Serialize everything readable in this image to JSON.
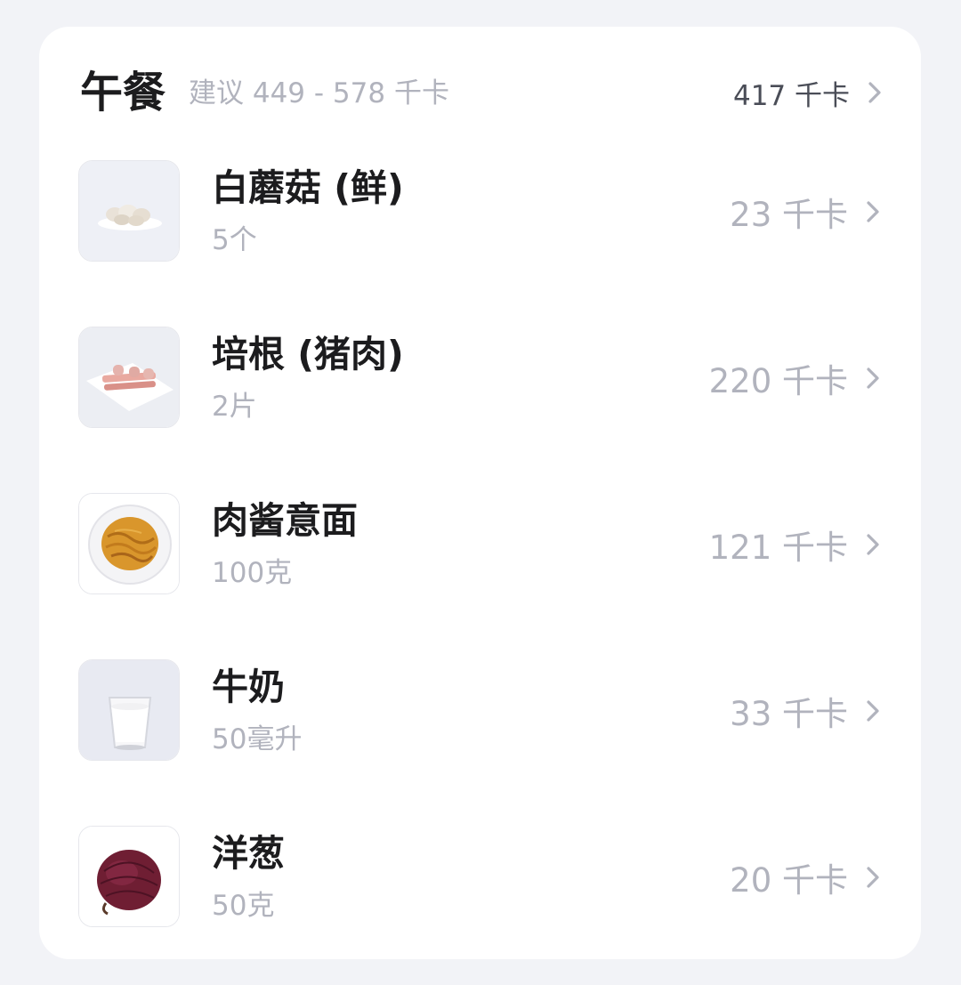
{
  "meal": {
    "title": "午餐",
    "suggestion": "建议 449 - 578 千卡",
    "total": "417 千卡"
  },
  "foods": [
    {
      "name": "白蘑菇 (鲜)",
      "amount": "5个",
      "kcal": "23 千卡",
      "icon": "mushroom-thumb"
    },
    {
      "name": "培根 (猪肉)",
      "amount": "2片",
      "kcal": "220 千卡",
      "icon": "bacon-thumb"
    },
    {
      "name": "肉酱意面",
      "amount": "100克",
      "kcal": "121 千卡",
      "icon": "pasta-thumb"
    },
    {
      "name": "牛奶",
      "amount": "50毫升",
      "kcal": "33 千卡",
      "icon": "milk-thumb"
    },
    {
      "name": "洋葱",
      "amount": "50克",
      "kcal": "20 千卡",
      "icon": "onion-thumb"
    }
  ],
  "colors": {
    "background": "#f2f3f7",
    "card": "#ffffff",
    "title": "#1c1c1e",
    "muted": "#b1b3bd",
    "total": "#4a4d57"
  }
}
